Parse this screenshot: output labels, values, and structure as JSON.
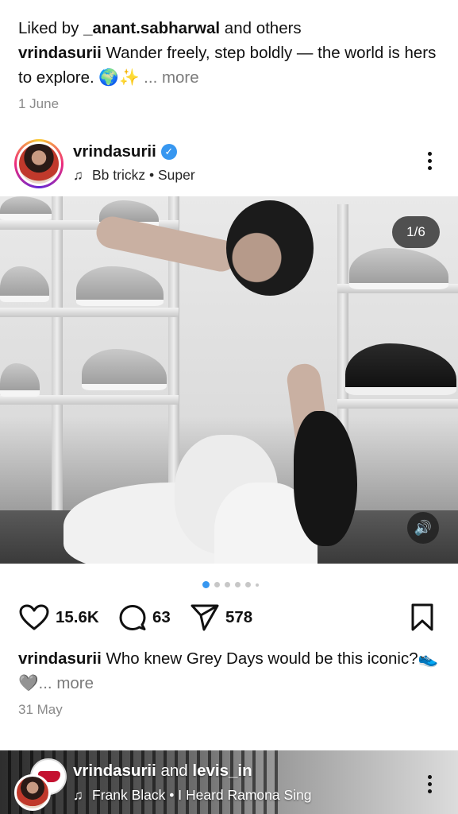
{
  "previous_post": {
    "liked_by_prefix": "Liked by ",
    "liked_by_user": "_anant.sabharwal",
    "liked_by_suffix": " and others",
    "caption_user": "vrindasurii",
    "caption_text": " Wander freely, step boldly — the world is hers to explore. 🌍✨",
    "more_label": "... more",
    "date": "1 June"
  },
  "post": {
    "username": "vrindasurii",
    "verified_glyph": "✓",
    "audio": "Bb trickz • Super",
    "media_counter": "1/6",
    "carousel": {
      "count": 6,
      "active_index": 0
    },
    "likes": "15.6K",
    "comments": "63",
    "shares": "578",
    "caption_user": "vrindasurii",
    "caption_text": " Who knew Grey Days would be this iconic?👟🩶",
    "more_label": "... more",
    "date": "31 May"
  },
  "next_post": {
    "user_a": "vrindasurii",
    "and_text": " and ",
    "user_b": "levis_in",
    "audio": "Frank Black • I Heard Ramona Sing"
  },
  "icons": {
    "music": "music-note-icon",
    "sound": "speaker-icon",
    "more": "kebab-menu-icon",
    "like": "heart-icon",
    "comment": "comment-bubble-icon",
    "share": "paper-plane-icon",
    "save": "bookmark-icon",
    "music_glyph": "♫",
    "sound_glyph": "🔊"
  },
  "colors": {
    "accent_blue": "#3797f0",
    "text": "#111111",
    "muted": "#8a8a8a"
  }
}
